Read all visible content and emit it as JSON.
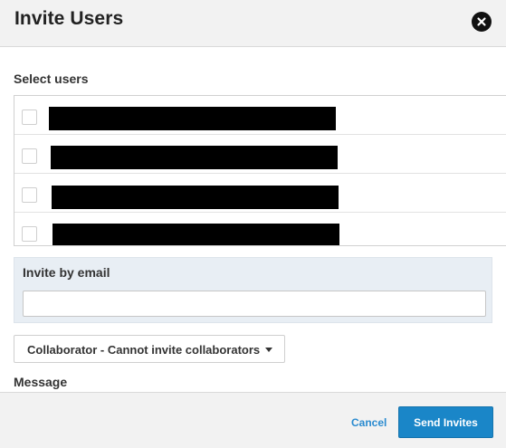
{
  "dialog": {
    "title": "Invite Users",
    "close_icon": "close-icon"
  },
  "select_users": {
    "label": "Select users",
    "rows": [
      {
        "checked": false,
        "name_redacted": true
      },
      {
        "checked": false,
        "name_redacted": true
      },
      {
        "checked": false,
        "name_redacted": true
      },
      {
        "checked": false,
        "name_redacted": true
      }
    ]
  },
  "invite_email": {
    "label": "Invite by email",
    "value": "",
    "placeholder": ""
  },
  "role": {
    "selected": "Collaborator - Cannot invite collaborators"
  },
  "message": {
    "label": "Message"
  },
  "footer": {
    "cancel_label": "Cancel",
    "send_label": "Send Invites"
  },
  "colors": {
    "accent": "#1a86c8",
    "link": "#2a8bd0",
    "panel": "#e8eef4"
  }
}
